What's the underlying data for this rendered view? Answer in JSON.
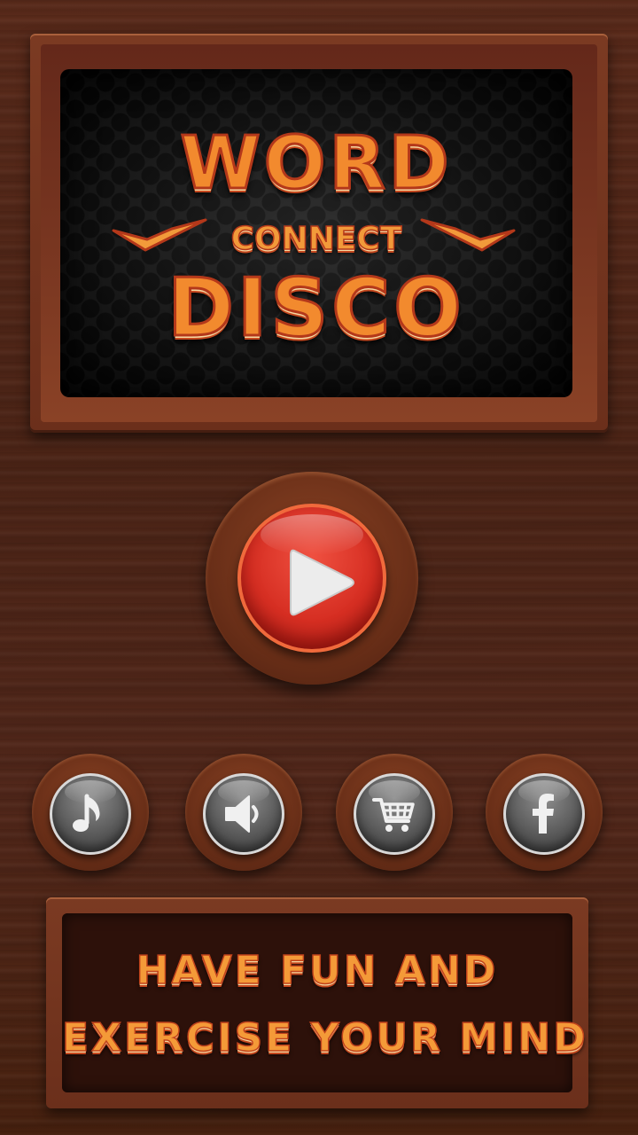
{
  "logo": {
    "word": "WORD",
    "connect": "CONNECT",
    "disco": "DISCO"
  },
  "play_button": {
    "icon": "play-icon"
  },
  "menu_buttons": [
    {
      "name": "music",
      "icon": "music-note-icon"
    },
    {
      "name": "sound",
      "icon": "speaker-icon"
    },
    {
      "name": "shop",
      "icon": "cart-icon"
    },
    {
      "name": "facebook",
      "icon": "facebook-icon"
    }
  ],
  "banner": {
    "line1": "HAVE FUN AND",
    "line2": "EXERCISE YOUR MIND"
  },
  "colors": {
    "title_orange": "#f28a2e",
    "title_outline": "#b4381a",
    "play_red": "#d62e22",
    "wood": "#52271a"
  }
}
